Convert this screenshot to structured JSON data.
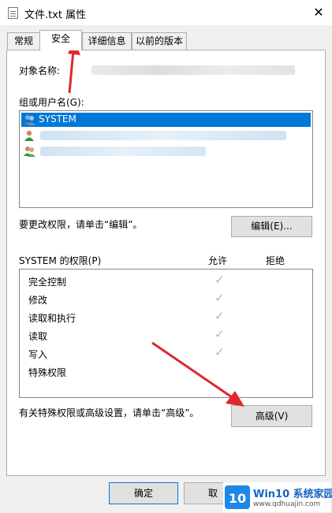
{
  "window": {
    "title": "文件.txt 属性",
    "close_glyph": "✕"
  },
  "tabs": [
    {
      "label": "常规"
    },
    {
      "label": "安全"
    },
    {
      "label": "详细信息"
    },
    {
      "label": "以前的版本"
    }
  ],
  "security": {
    "object_name_label": "对象名称:",
    "group_label": "组或用户名(G):",
    "users": [
      {
        "name": "SYSTEM",
        "selected": true
      },
      {
        "name": "",
        "selected": false
      },
      {
        "name": "",
        "selected": false
      }
    ],
    "edit_hint": "要更改权限，请单击“编辑”。",
    "edit_button": "编辑(E)...",
    "perm_header": "SYSTEM 的权限(P)",
    "allow_header": "允许",
    "deny_header": "拒绝",
    "permissions": [
      {
        "name": "完全控制",
        "allow": "✓"
      },
      {
        "name": "修改",
        "allow": "✓"
      },
      {
        "name": "读取和执行",
        "allow": "✓"
      },
      {
        "name": "读取",
        "allow": "✓"
      },
      {
        "name": "写入",
        "allow": "✓"
      },
      {
        "name": "特殊权限",
        "allow": ""
      }
    ],
    "advanced_hint": "有关特殊权限或高级设置，请单击“高级”。",
    "advanced_button": "高级(V)"
  },
  "footer": {
    "ok_button": "确定",
    "cancel_button": "取"
  },
  "watermark": {
    "brand": "Win10 系统家园",
    "url": "www.qdhuajin.com"
  },
  "colors": {
    "accent": "#0078d7",
    "arrow": "#e0282c"
  }
}
